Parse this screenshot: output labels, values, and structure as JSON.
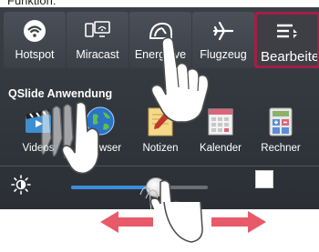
{
  "top_cut_text": "Funktion:",
  "quick_settings": [
    {
      "label": "Hotspot",
      "icon": "wifi-hotspot-icon"
    },
    {
      "label": "Miracast",
      "icon": "miracast-icon"
    },
    {
      "label": "Energieve",
      "icon": "energy-saver-icon"
    },
    {
      "label": "Flugzeug",
      "icon": "airplane-icon"
    },
    {
      "label": "Bearbeite",
      "icon": "edit-list-icon"
    }
  ],
  "qslide": {
    "title": "QSlide Anwendung",
    "apps": [
      {
        "label": "Videos",
        "icon": "video-clapper-icon"
      },
      {
        "label": "wser",
        "icon": "browser-globe-icon"
      },
      {
        "label": "Notizen",
        "icon": "notepad-icon"
      },
      {
        "label": "Kalender",
        "icon": "calendar-icon"
      },
      {
        "label": "Rechner",
        "icon": "calculator-icon"
      }
    ]
  },
  "brightness": {
    "level": 0.62,
    "icon": "brightness-sun-icon"
  },
  "colors": {
    "accent_blue": "#3b8ddc",
    "edit_border": "#a21f46",
    "arrow_red": "#e85a69"
  }
}
